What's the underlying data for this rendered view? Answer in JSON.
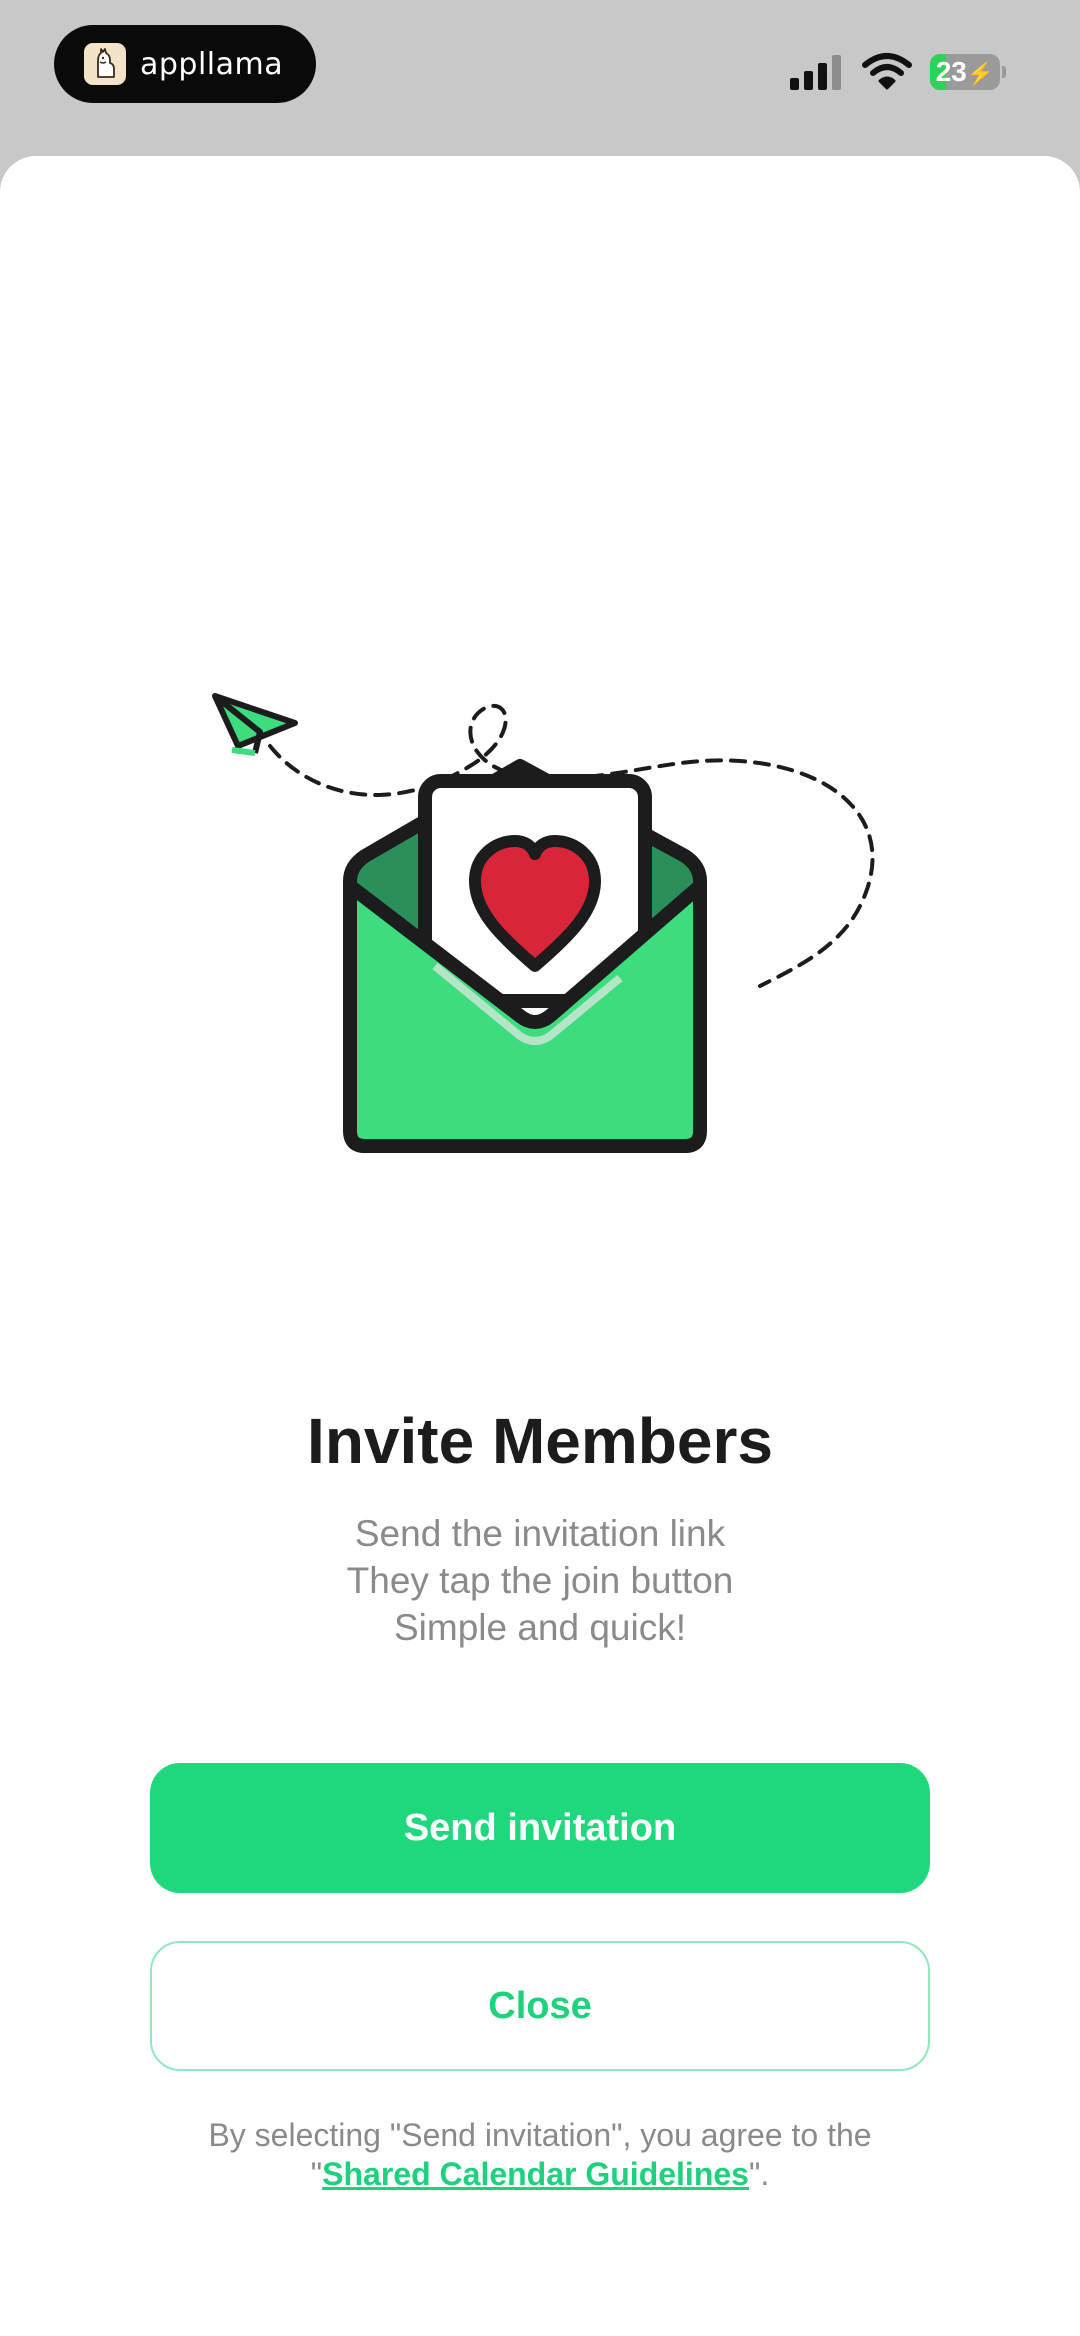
{
  "status_bar": {
    "app_name": "appllama",
    "battery_level": "23",
    "battery_fraction": 0.23,
    "icons": [
      "llama-logo-icon",
      "signal-icon",
      "wifi-icon",
      "battery-charging-icon"
    ]
  },
  "content": {
    "illustration_icons": [
      "paper-plane-icon",
      "envelope-heart-icon"
    ],
    "title": "Invite Members",
    "subtitle_lines": [
      "Send the invitation link",
      "They tap the join button",
      "Simple and quick!"
    ],
    "primary_button": "Send invitation",
    "secondary_button": "Close",
    "disclaimer": {
      "prefix": "By selecting \"Send invitation\", you agree to the",
      "link_open_quote": "\"",
      "link_text": "Shared Calendar Guidelines",
      "suffix": "\"."
    }
  },
  "colors": {
    "accent_green": "#1fd87e",
    "envelope_green": "#3ddc7e",
    "envelope_dark_green": "#2b8f5c",
    "heart_red": "#d8253a",
    "text_dark": "#1c1c1c",
    "text_gray": "#8a8a8a"
  }
}
